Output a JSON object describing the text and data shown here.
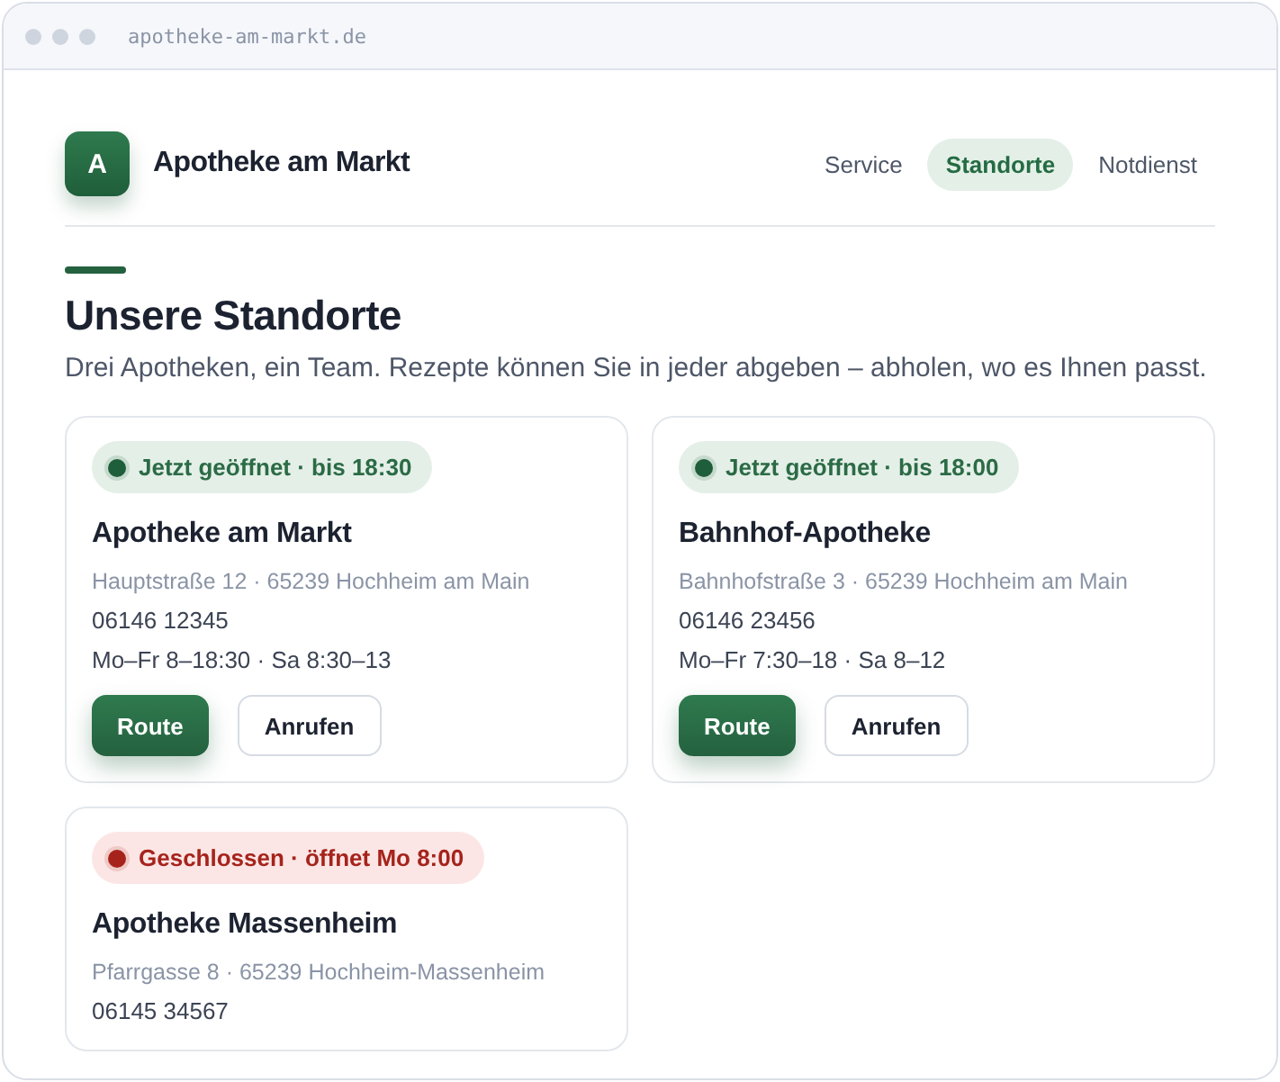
{
  "browser": {
    "url": "apotheke-am-markt.de"
  },
  "header": {
    "logo_letter": "A",
    "brand": "Apotheke am Markt",
    "nav": [
      {
        "label": "Service",
        "selected": false
      },
      {
        "label": "Standorte",
        "selected": true
      },
      {
        "label": "Notdienst",
        "selected": false
      }
    ]
  },
  "section": {
    "title": "Unsere Standorte",
    "intro": "Drei Apotheken, ein Team. Rezepte können Sie in jeder abgeben – abholen, wo es Ihnen passt."
  },
  "locations": [
    {
      "status": {
        "kind": "open",
        "label": "Jetzt geöffnet · bis 18:30"
      },
      "name": "Apotheke am Markt",
      "address": "Hauptstraße 12 · 65239 Hochheim am Main",
      "phone": "06146 12345",
      "hours": "Mo–Fr 8–18:30 · Sa 8:30–13",
      "buttons": [
        "Route",
        "Anrufen"
      ]
    },
    {
      "status": {
        "kind": "open",
        "label": "Jetzt geöffnet · bis 18:00"
      },
      "name": "Bahnhof-Apotheke",
      "address": "Bahnhofstraße 3 · 65239 Hochheim am Main",
      "phone": "06146 23456",
      "hours": "Mo–Fr 7:30–18 · Sa 8–12",
      "buttons": [
        "Route",
        "Anrufen"
      ]
    },
    {
      "status": {
        "kind": "closed",
        "label": "Geschlossen · öffnet Mo 8:00"
      },
      "name": "Apotheke Massenheim",
      "address": "Pfarrgasse 8 · 65239 Hochheim-Massenheim",
      "phone": "06145 34567"
    }
  ]
}
